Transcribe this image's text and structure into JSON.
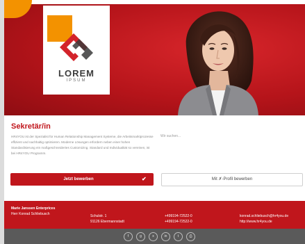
{
  "brand": {
    "logo_text": "LOREM",
    "logo_sub": "IPSUM",
    "accent": "#c0161c",
    "orange": "#f39200"
  },
  "job": {
    "title": "Sekretär/in",
    "description": "HR4YOU ist der Spezialist für Human Relationship Management Systeme, die Arbeitsmarktprozesse effizient und nachhaltig optimieren. Moderne Lösungen erfordern neben einer hohen Standardisierung ein maßgeschneidertes Customizing. Standard und Individualität so vereinen, ist bei HR4YOU Programm.",
    "search_text": "Wir suchen..."
  },
  "buttons": {
    "apply_label": "Jetzt bewerben",
    "xing_label": "Mit ✗-Profil bewerben"
  },
  "footer": {
    "company": "Marie Janssen Enterprices",
    "contact": "Herr Konrad Schliebusch",
    "street": "Schulstr. 1",
    "city": "91126 Ebermannstadt",
    "phone1": "+499194-72522-0",
    "phone2": "+499194-72522-0",
    "email": "konrad.schliebusch@hr4you.de",
    "web": "http://www.hr4you.de"
  },
  "social": [
    {
      "icon": "facebook-icon",
      "glyph": "f"
    },
    {
      "icon": "google-plus-icon",
      "glyph": "g"
    },
    {
      "icon": "xing-icon",
      "glyph": "x"
    },
    {
      "icon": "linkedin-icon",
      "glyph": "in"
    },
    {
      "icon": "twitter-icon",
      "glyph": "t"
    },
    {
      "icon": "print-icon",
      "glyph": "⎙"
    }
  ]
}
